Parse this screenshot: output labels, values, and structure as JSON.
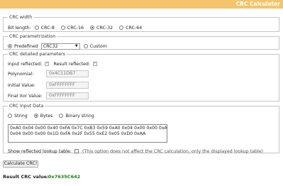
{
  "header": {
    "title": "CRC Calculator"
  },
  "crc_width": {
    "legend": "CRC width",
    "label": "Bit length:",
    "options": [
      "CRC-8",
      "CRC-16",
      "CRC-32",
      "CRC-64"
    ],
    "selected": "CRC-32"
  },
  "parametrization": {
    "legend": "CRC parametrization",
    "predefined_label": "Predefined",
    "predefined_value": "CRC32",
    "custom_label": "Custom"
  },
  "detailed": {
    "legend": "CRC detailed parameters",
    "input_reflected_label": "Input reflected:",
    "result_reflected_label": "Result reflected:",
    "polynomial_label": "Polynomial:",
    "polynomial_value": "0x4C11DB7",
    "initial_label": "Initial Value:",
    "initial_value": "0xFFFFFFFF",
    "final_xor_label": "Final Xor Value:",
    "final_xor_value": "0xFFFFFFFF"
  },
  "input_data": {
    "legend": "CRC Input Data",
    "string_label": "String",
    "bytes_label": "Bytes",
    "binary_label": "Binary string",
    "text": "0xA0 0x04 0x00 0x40 0xFA 0x7C 0xB3 0x59 0xA0 0x04 0x00 0x00 0xA0\n0x04 0x00 0x00 0x1D 0xFA 0x2F 0x55 0xE2 0x05 0xD0 0xAA",
    "lookup_label": "Show reflected lookup table:",
    "lookup_note": "(This option does not affect the CRC calculation, only the displayed lookup table)"
  },
  "actions": {
    "calculate_label": "Calculate CRC!"
  },
  "result": {
    "label": "Result CRC value:",
    "value": "0x7635C642"
  }
}
